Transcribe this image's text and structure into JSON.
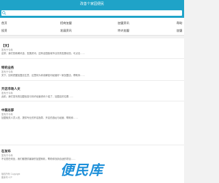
{
  "header": {
    "title": "改善个家园便民"
  },
  "search": {
    "placeholder": ""
  },
  "nav": {
    "row1": [
      "首页",
      "招商加盟",
      "加盟资讯",
      "帮助"
    ],
    "row2": [
      "投资",
      "发展资讯",
      "特许加盟",
      "加盟"
    ]
  },
  "articles": [
    {
      "title": "【文】",
      "meta": "发布于今年",
      "summary": "这样，我们的新闻讯息、发展资讯，还有全国各城市业务的发展动态，可点击……"
    },
    {
      "title": "特的业务",
      "meta": "发布于今年",
      "summary": "关于，如何把握加盟店生意，这里将为你讲解如何经营好一家加盟店，帮助你……"
    },
    {
      "title": "开店市场人文",
      "meta": "发布于今年",
      "summary": "此前，我们发布的加盟信息与特许经营资讯介绍了，加盟店的位置……"
    },
    {
      "title": "中国总部",
      "meta": "发布于今年",
      "summary": "加盟相关人员入驻，提供专业的开店指导，开店的选址与经营，帮助你……"
    },
    {
      "title": "在发布",
      "meta": "发布于今年",
      "summary": "不论您在何处，我们都提供最新的加盟商机，帮助你找到合适的项目……"
    }
  ],
  "footer": [
    "版权所有 Copyright",
    "备案号 ICP"
  ],
  "watermark": {
    "text": "便民库"
  }
}
